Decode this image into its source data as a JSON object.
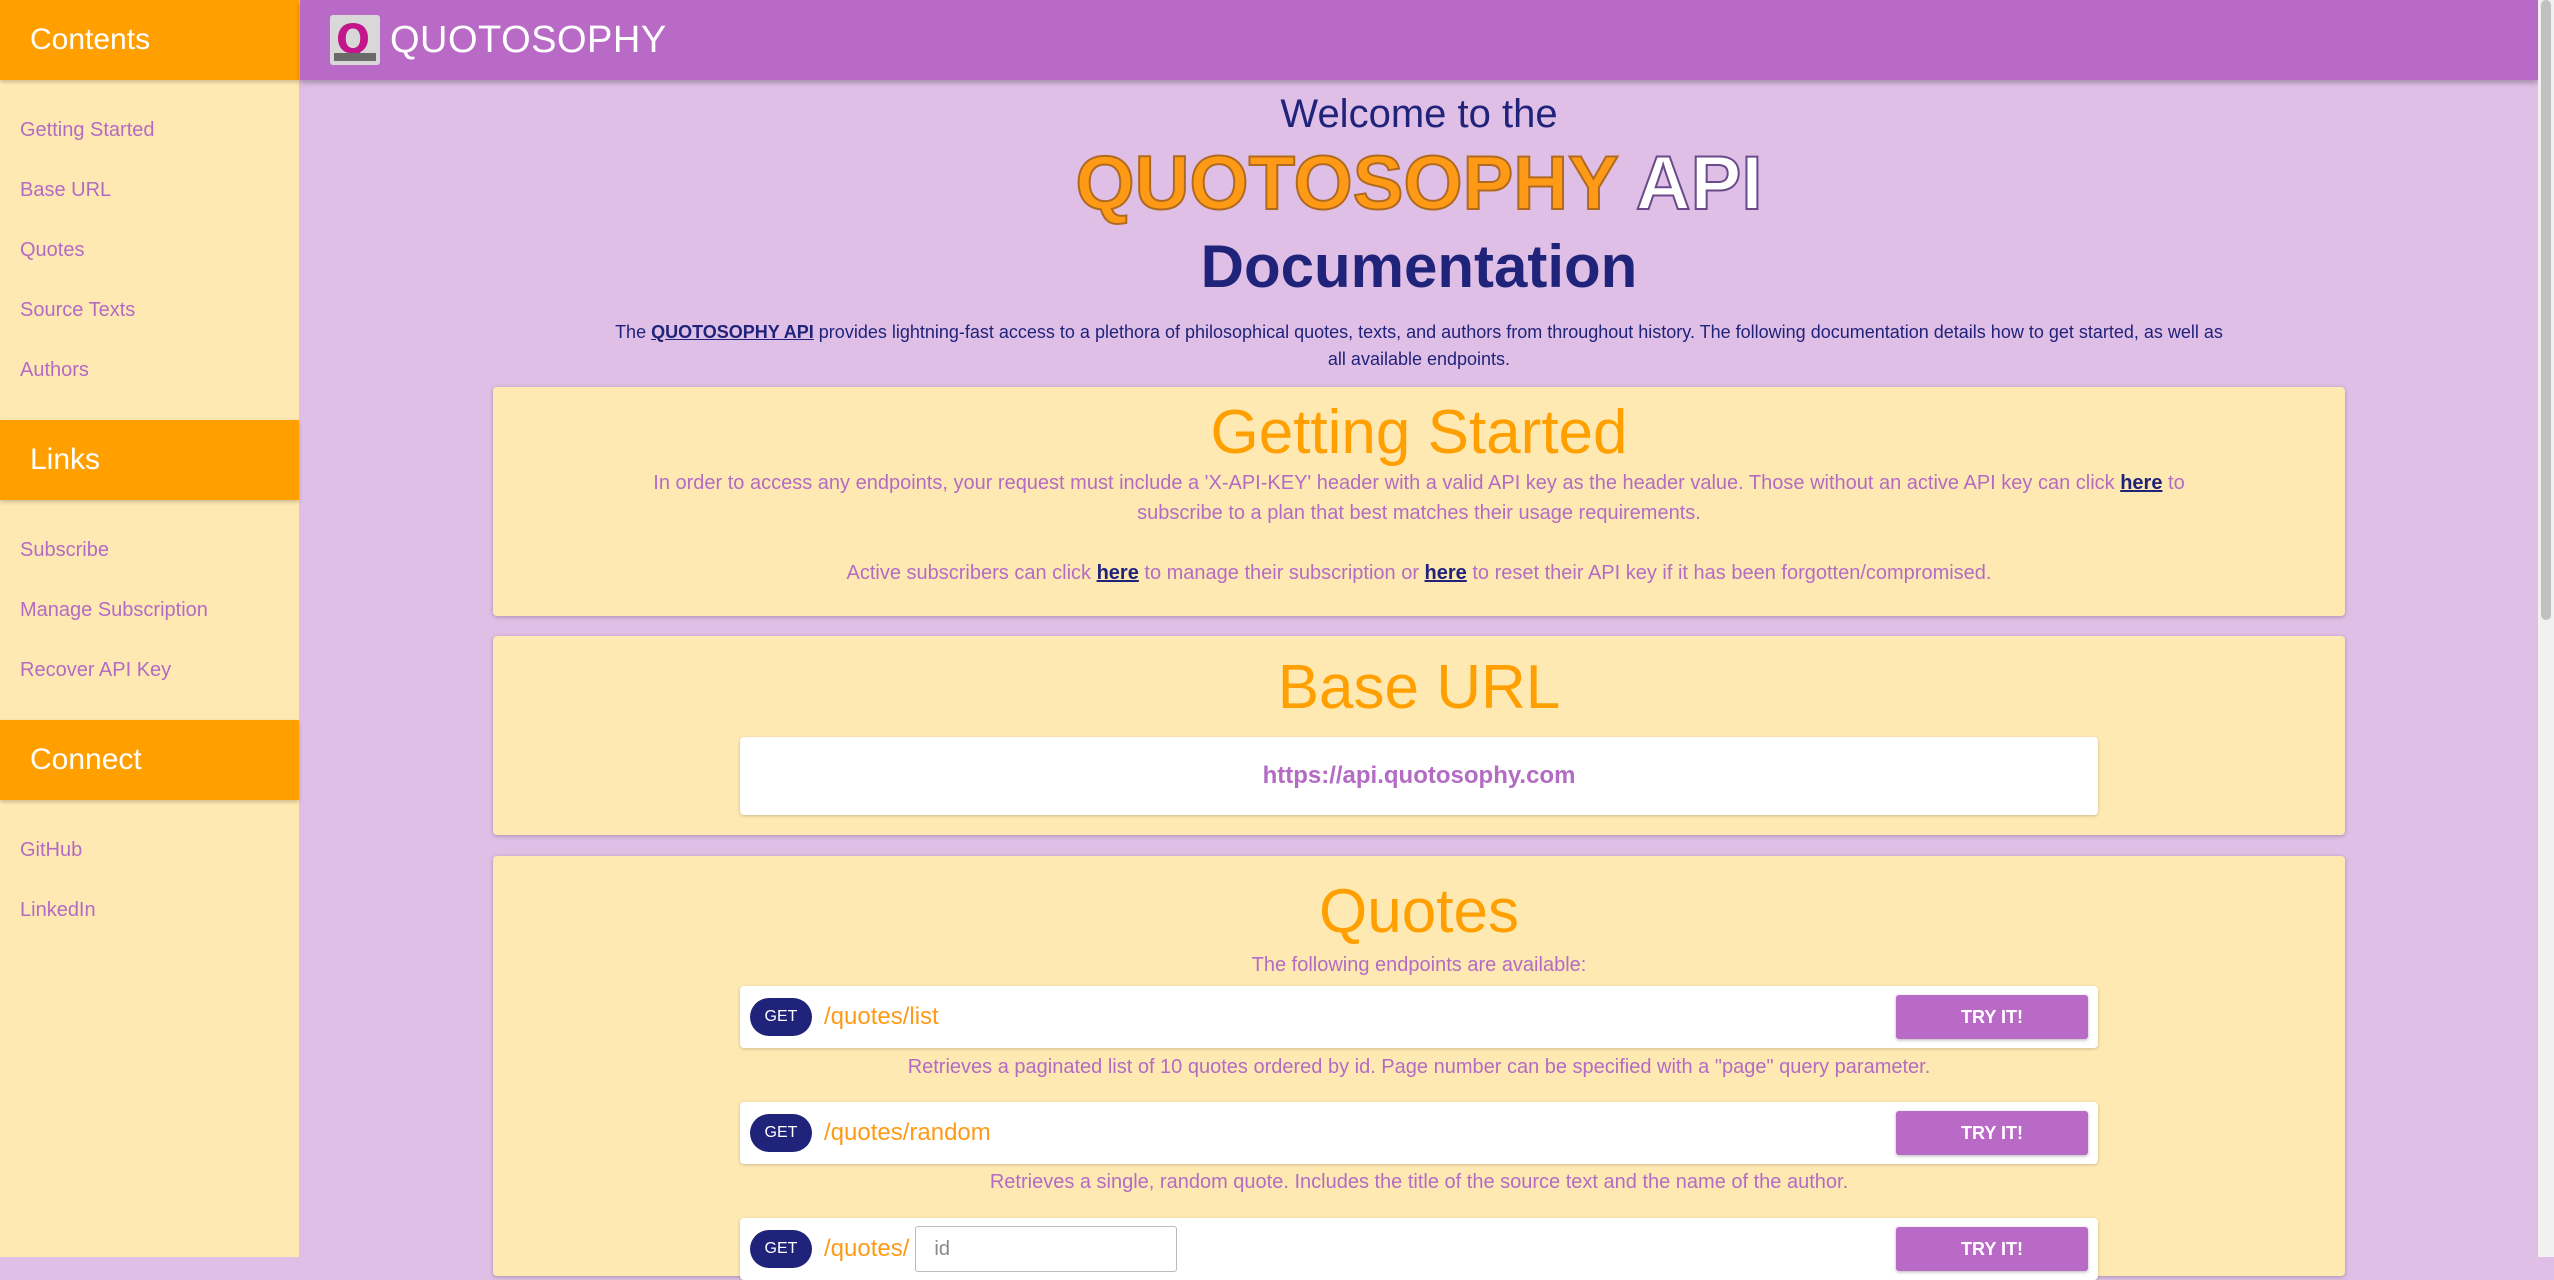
{
  "sidebar": {
    "sections": [
      {
        "title": "Contents",
        "items": [
          "Getting Started",
          "Base URL",
          "Quotes",
          "Source Texts",
          "Authors"
        ]
      },
      {
        "title": "Links",
        "items": [
          "Subscribe",
          "Manage Subscription",
          "Recover API Key"
        ]
      },
      {
        "title": "Connect",
        "items": [
          "GitHub",
          "LinkedIn"
        ]
      }
    ]
  },
  "header": {
    "logo_letter": "Q",
    "brand": "QUOTOSOPHY"
  },
  "hero": {
    "welcome": "Welcome to the",
    "title_brand": "QUOTOSOPHY",
    "title_api": "API",
    "subtitle": "Documentation",
    "intro_pre": "The ",
    "intro_link": "QUOTOSOPHY API",
    "intro_post": " provides lightning-fast access to a plethora of philosophical quotes, texts, and authors from throughout history. The following documentation details how to get started, as well as all available endpoints."
  },
  "getting_started": {
    "title": "Getting Started",
    "p1_pre": "In order to access any endpoints, your request must include a 'X-API-KEY' header with a valid API key as the header value. Those without an active API key can click ",
    "p1_link": "here",
    "p1_post": " to subscribe to a plan that best matches their usage requirements.",
    "p2_pre": "Active subscribers can click ",
    "p2_link1": "here",
    "p2_mid": " to manage their subscription or ",
    "p2_link2": "here",
    "p2_post": " to reset their API key if it has been forgotten/compromised."
  },
  "base_url": {
    "title": "Base URL",
    "url": "https://api.quotosophy.com"
  },
  "quotes": {
    "title": "Quotes",
    "lead": "The following endpoints are available:",
    "endpoints": [
      {
        "method": "GET",
        "path": "/quotes/list",
        "button": "TRY IT!",
        "desc": "Retrieves a paginated list of 10 quotes ordered by id. Page number can be specified with a \"page\" query parameter."
      },
      {
        "method": "GET",
        "path": "/quotes/random",
        "button": "TRY IT!",
        "desc": "Retrieves a single, random quote. Includes the title of the source text and the name of the author."
      },
      {
        "method": "GET",
        "path": "/quotes/",
        "button": "TRY IT!",
        "placeholder": "id"
      }
    ]
  }
}
